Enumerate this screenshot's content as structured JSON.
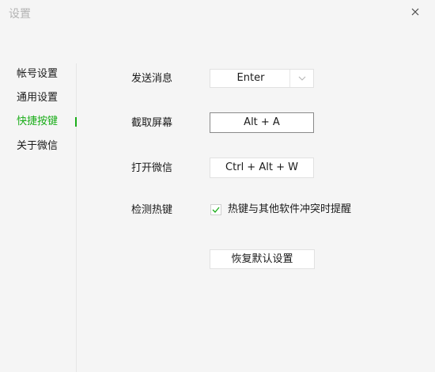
{
  "window": {
    "title": "设置"
  },
  "sidebar": {
    "items": [
      {
        "label": "帐号设置"
      },
      {
        "label": "通用设置"
      },
      {
        "label": "快捷按键",
        "active": true
      },
      {
        "label": "关于微信"
      }
    ]
  },
  "shortcuts": {
    "send_message": {
      "label": "发送消息",
      "value": "Enter"
    },
    "screenshot": {
      "label": "截取屏幕",
      "value": "Alt + A"
    },
    "open_wechat": {
      "label": "打开微信",
      "value": "Ctrl + Alt + W"
    },
    "detect_hotkey": {
      "label": "检测热键",
      "checkbox_label": "热键与其他软件冲突时提醒",
      "checked": true
    }
  },
  "actions": {
    "reset_label": "恢复默认设置"
  },
  "colors": {
    "accent": "#1aad19",
    "background": "#f5f5f5"
  },
  "icons": {
    "close": "close-icon",
    "dropdown": "chevron-down-icon",
    "check": "check-icon"
  }
}
